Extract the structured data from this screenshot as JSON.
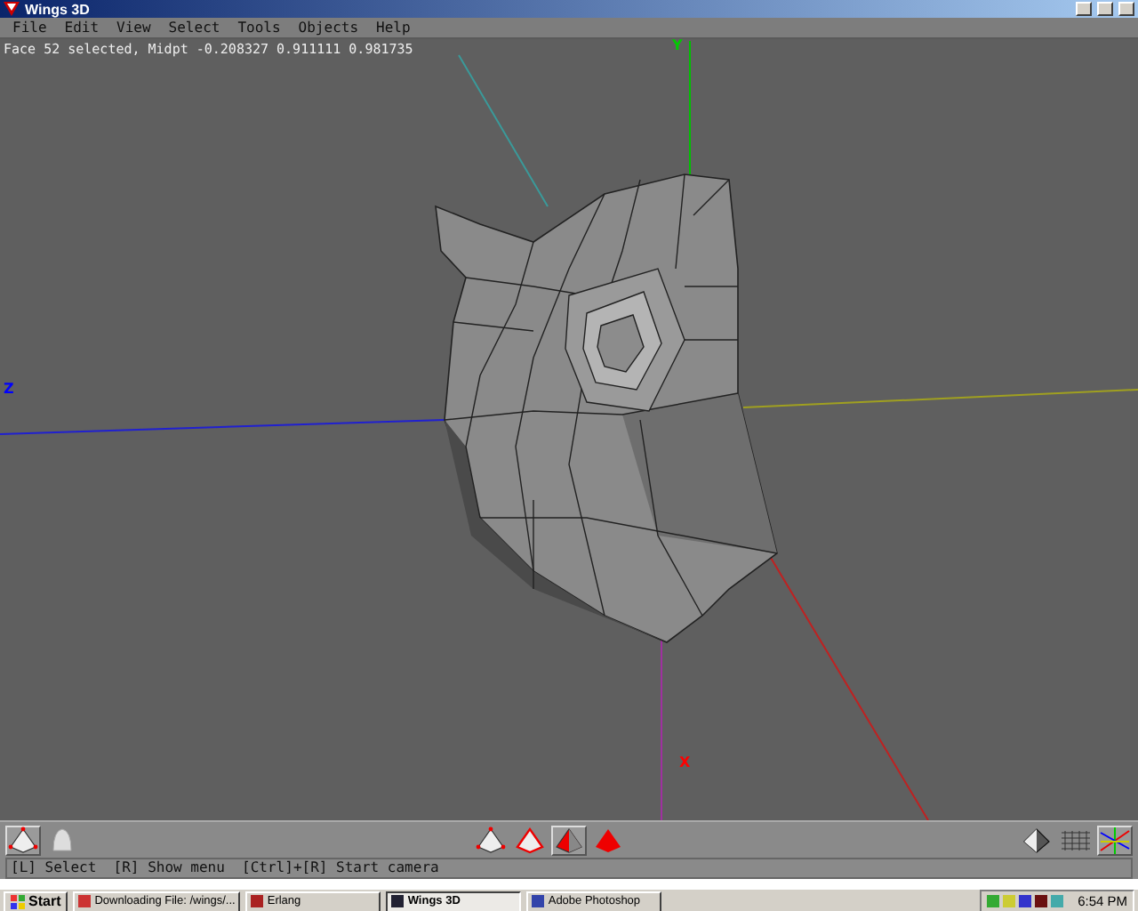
{
  "window": {
    "title": "Wings 3D"
  },
  "menu": [
    "File",
    "Edit",
    "View",
    "Select",
    "Tools",
    "Objects",
    "Help"
  ],
  "info_line": "Face 52 selected, Midpt -0.208327 0.911111 0.981735",
  "axis_labels": [
    {
      "text": "Y",
      "color": "#00cc00"
    },
    {
      "text": "Z",
      "color": "#0000ff"
    },
    {
      "text": "X",
      "color": "#ff0000"
    }
  ],
  "toolbar": {
    "left": [
      {
        "kind": "vertex",
        "selected": true
      },
      {
        "kind": "smooth",
        "selected": false
      }
    ],
    "modes": [
      {
        "kind": "vertex",
        "selected": false
      },
      {
        "kind": "edge",
        "selected": false
      },
      {
        "kind": "face",
        "selected": true
      },
      {
        "kind": "body",
        "selected": false
      }
    ],
    "views": [
      {
        "kind": "shaded",
        "selected": false
      },
      {
        "kind": "grid",
        "selected": false
      },
      {
        "kind": "axes",
        "selected": true
      }
    ]
  },
  "status_bar": "[L] Select  [R] Show menu  [Ctrl]+[R] Start camera",
  "taskbar": {
    "start": "Start",
    "tasks": [
      {
        "label": "Downloading File: /wings/...",
        "selected": false
      },
      {
        "label": "Erlang",
        "selected": false
      },
      {
        "label": "Wings 3D",
        "selected": true
      },
      {
        "label": "Adobe Photoshop",
        "selected": false
      }
    ],
    "clock": "6:54 PM"
  }
}
